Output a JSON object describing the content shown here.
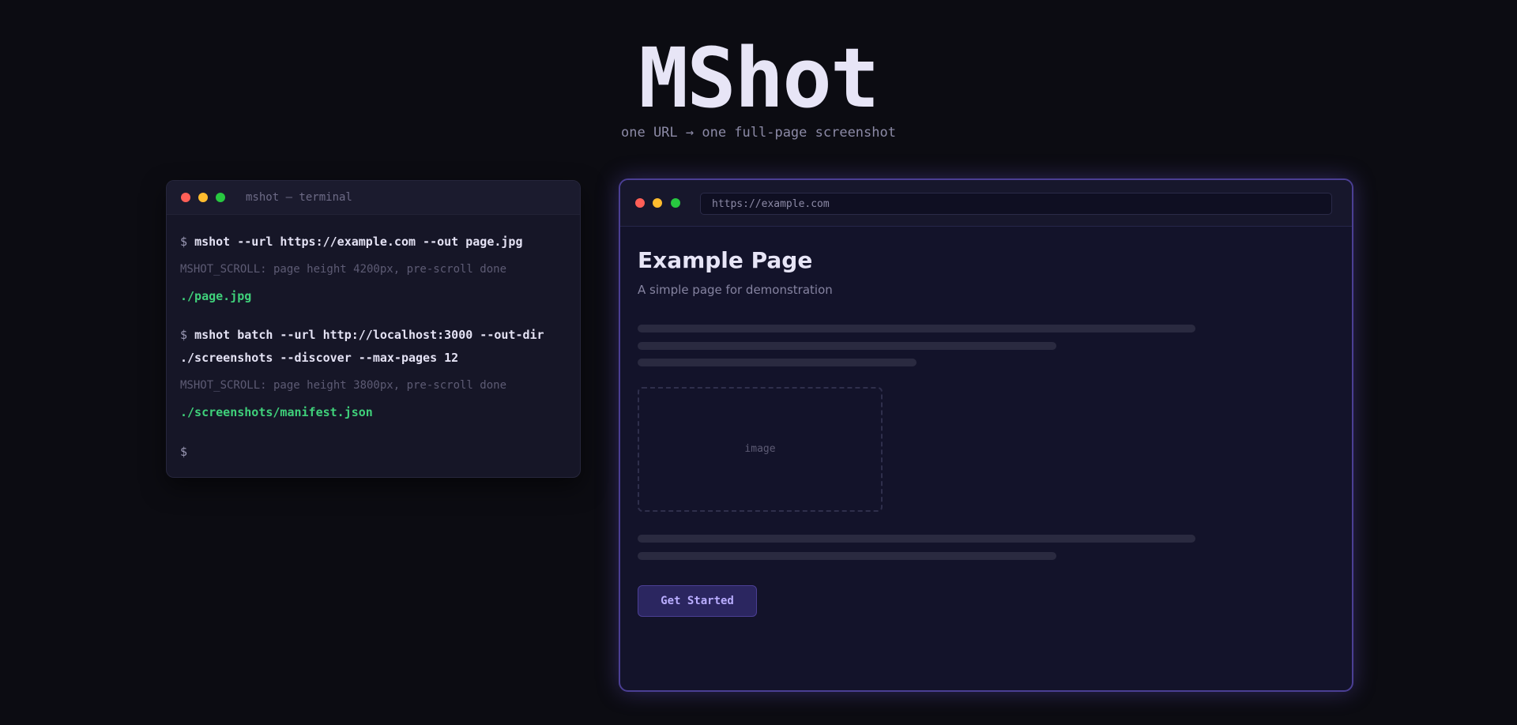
{
  "hero": {
    "title": "MShot",
    "tagline": "one URL → one full-page screenshot"
  },
  "terminal": {
    "title": "mshot — terminal",
    "prompt": "$",
    "lines": [
      {
        "kind": "command",
        "text": "mshot --url https://example.com --out page.jpg"
      },
      {
        "kind": "log",
        "text": "MSHOT_SCROLL: page height 4200px, pre-scroll done"
      },
      {
        "kind": "output",
        "text": "./page.jpg"
      },
      {
        "kind": "command",
        "text": "mshot batch --url http://localhost:3000 --out-dir"
      },
      {
        "kind": "command-continued",
        "text": "./screenshots --discover --max-pages 12"
      },
      {
        "kind": "log",
        "text": "MSHOT_SCROLL: page height 3800px, pre-scroll done"
      },
      {
        "kind": "output",
        "text": "./screenshots/manifest.json"
      },
      {
        "kind": "prompt",
        "text": ""
      }
    ]
  },
  "browser": {
    "url": "https://example.com",
    "page": {
      "heading": "Example Page",
      "description": "A simple page for demonstration",
      "image_label": "image",
      "button_label": "Get Started"
    }
  },
  "colors": {
    "background": "#0c0c12",
    "accent": "#4b3f94",
    "button_text": "#b9adff",
    "output_green": "#3fd07a",
    "dot_red": "#ff5f57",
    "dot_yellow": "#febc2e",
    "dot_green": "#28c840"
  }
}
